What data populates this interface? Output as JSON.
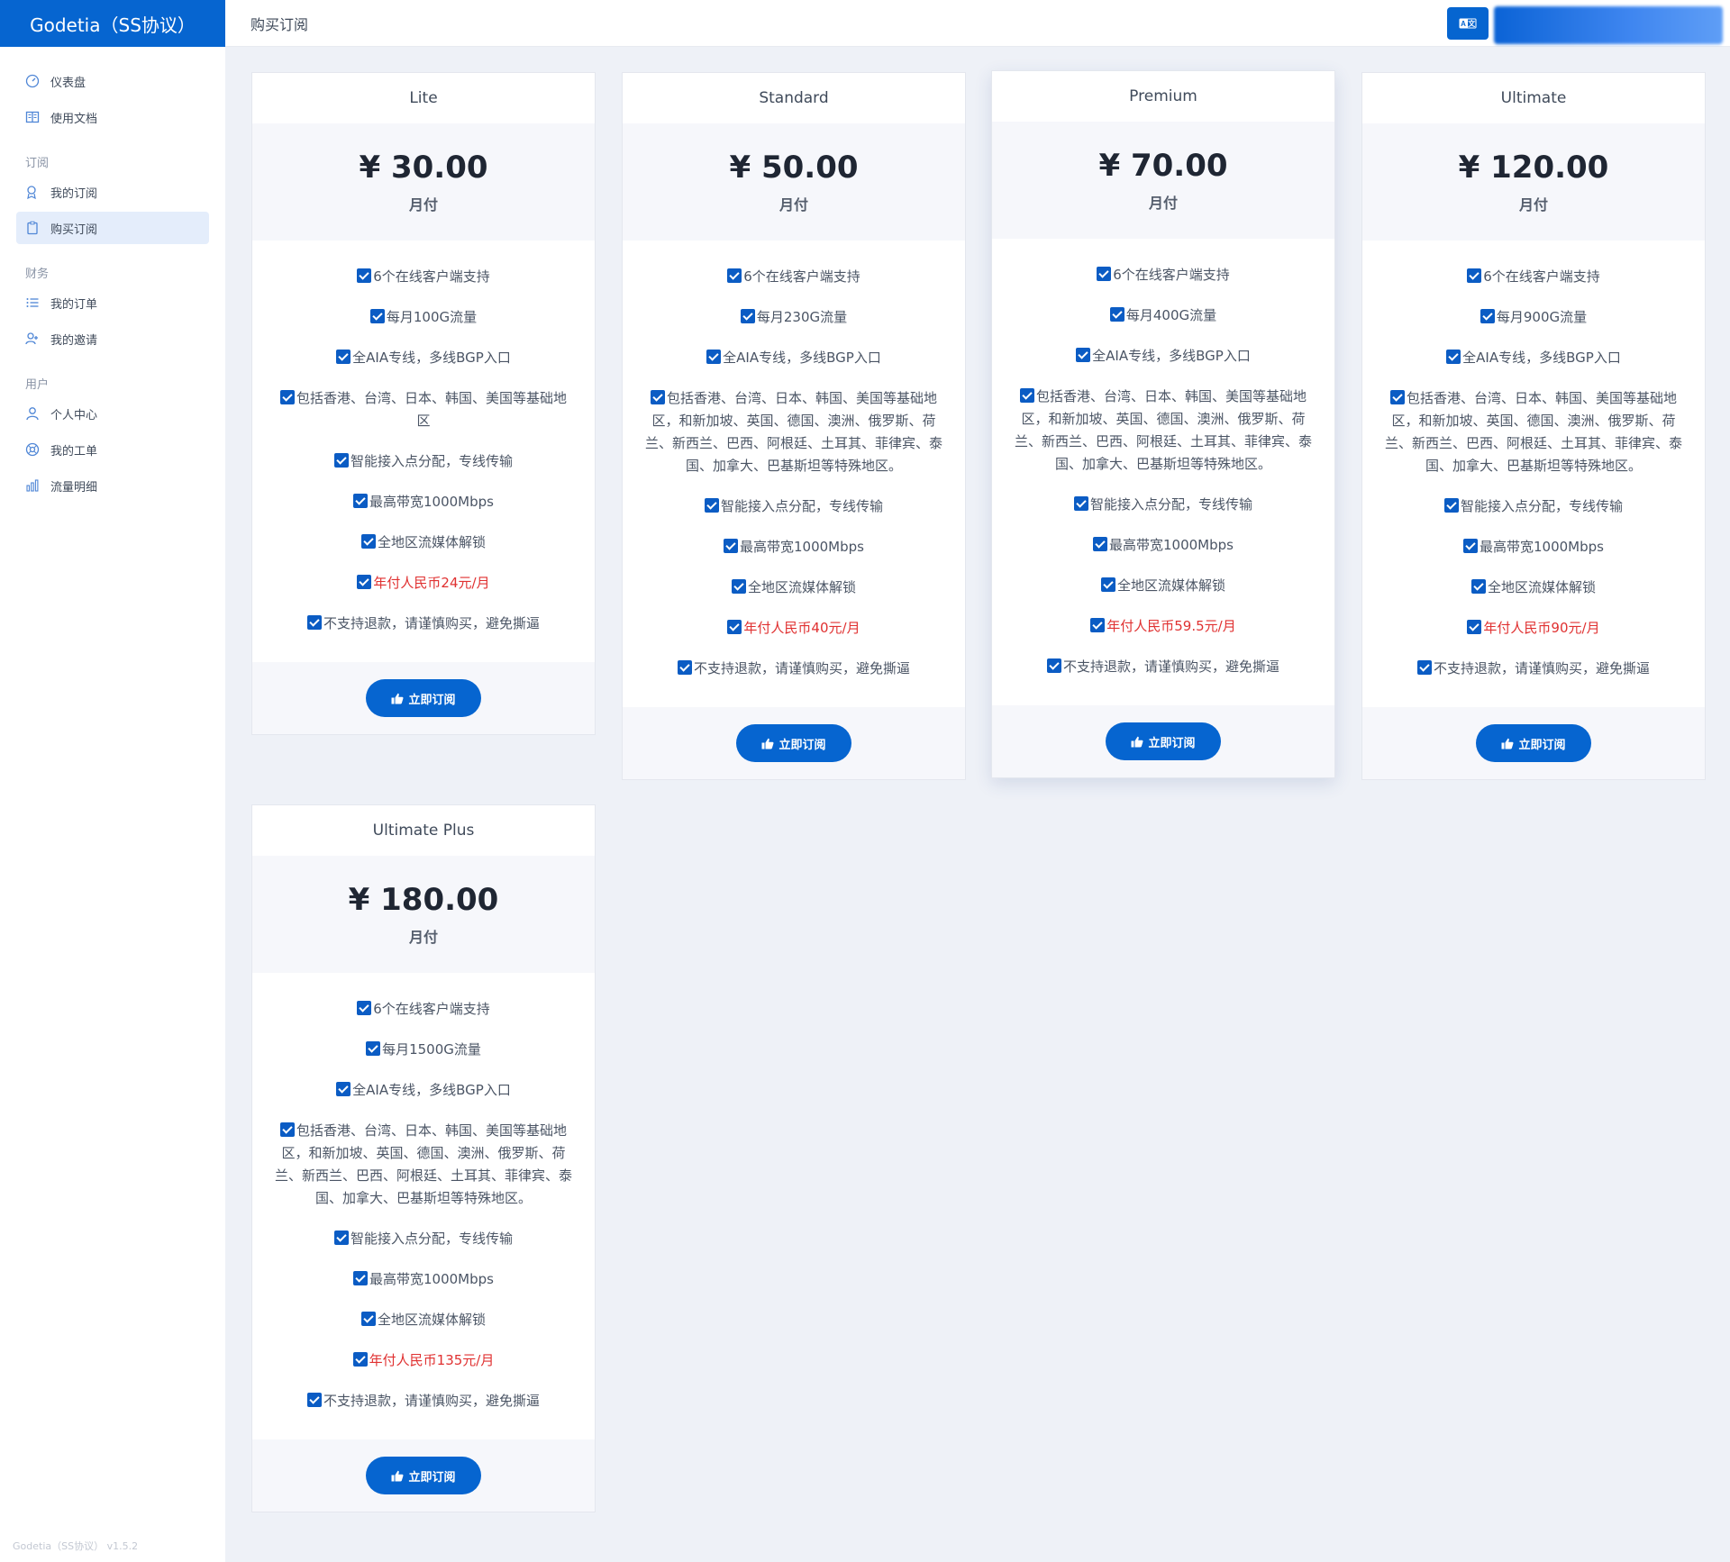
{
  "brand": "Godetia（SS协议）",
  "header": {
    "title": "购买订阅"
  },
  "sidebar": {
    "items": [
      {
        "label": "仪表盘",
        "icon": "dashboard-icon"
      },
      {
        "label": "使用文档",
        "icon": "book-icon"
      }
    ],
    "groups": [
      {
        "title": "订阅",
        "items": [
          {
            "label": "我的订阅",
            "icon": "subscription-icon"
          },
          {
            "label": "购买订阅",
            "icon": "clipboard-icon",
            "active": true
          }
        ]
      },
      {
        "title": "财务",
        "items": [
          {
            "label": "我的订单",
            "icon": "list-icon"
          },
          {
            "label": "我的邀请",
            "icon": "invite-icon"
          }
        ]
      },
      {
        "title": "用户",
        "items": [
          {
            "label": "个人中心",
            "icon": "user-icon"
          },
          {
            "label": "我的工单",
            "icon": "ticket-icon"
          },
          {
            "label": "流量明细",
            "icon": "bar-chart-icon"
          }
        ]
      }
    ],
    "footer": "Godetia（SS协议） v1.5.2"
  },
  "subscribe_label": "立即订阅",
  "plans": [
    {
      "name": "Lite",
      "price": "¥ 30.00",
      "period": "月付",
      "features": [
        {
          "text": "6个在线客户端支持"
        },
        {
          "text": "每月100G流量"
        },
        {
          "text": "全AIA专线，多线BGP入口"
        },
        {
          "text": "包括香港、台湾、日本、韩国、美国等基础地区"
        },
        {
          "text": "智能接入点分配，专线传输"
        },
        {
          "text": "最高带宽1000Mbps"
        },
        {
          "text": "全地区流媒体解锁"
        },
        {
          "text": "年付人民币24元/月",
          "red": true
        },
        {
          "text": "不支持退款，请谨慎购买，避免撕逼"
        }
      ]
    },
    {
      "name": "Standard",
      "price": "¥ 50.00",
      "period": "月付",
      "features": [
        {
          "text": "6个在线客户端支持"
        },
        {
          "text": "每月230G流量"
        },
        {
          "text": "全AIA专线，多线BGP入口"
        },
        {
          "text": "包括香港、台湾、日本、韩国、美国等基础地区，和新加坡、英国、德国、澳洲、俄罗斯、荷兰、新西兰、巴西、阿根廷、土耳其、菲律宾、泰国、加拿大、巴基斯坦等特殊地区。"
        },
        {
          "text": "智能接入点分配，专线传输"
        },
        {
          "text": "最高带宽1000Mbps"
        },
        {
          "text": "全地区流媒体解锁"
        },
        {
          "text": "年付人民币40元/月",
          "red": true
        },
        {
          "text": "不支持退款，请谨慎购买，避免撕逼"
        }
      ]
    },
    {
      "name": "Premium",
      "price": "¥ 70.00",
      "period": "月付",
      "features": [
        {
          "text": "6个在线客户端支持"
        },
        {
          "text": "每月400G流量"
        },
        {
          "text": "全AIA专线，多线BGP入口"
        },
        {
          "text": "包括香港、台湾、日本、韩国、美国等基础地区，和新加坡、英国、德国、澳洲、俄罗斯、荷兰、新西兰、巴西、阿根廷、土耳其、菲律宾、泰国、加拿大、巴基斯坦等特殊地区。"
        },
        {
          "text": "智能接入点分配，专线传输"
        },
        {
          "text": "最高带宽1000Mbps"
        },
        {
          "text": "全地区流媒体解锁"
        },
        {
          "text": "年付人民币59.5元/月",
          "red": true
        },
        {
          "text": "不支持退款，请谨慎购买，避免撕逼"
        }
      ]
    },
    {
      "name": "Ultimate",
      "price": "¥ 120.00",
      "period": "月付",
      "features": [
        {
          "text": "6个在线客户端支持"
        },
        {
          "text": "每月900G流量"
        },
        {
          "text": "全AIA专线，多线BGP入口"
        },
        {
          "text": "包括香港、台湾、日本、韩国、美国等基础地区，和新加坡、英国、德国、澳洲、俄罗斯、荷兰、新西兰、巴西、阿根廷、土耳其、菲律宾、泰国、加拿大、巴基斯坦等特殊地区。"
        },
        {
          "text": "智能接入点分配，专线传输"
        },
        {
          "text": "最高带宽1000Mbps"
        },
        {
          "text": "全地区流媒体解锁"
        },
        {
          "text": "年付人民币90元/月",
          "red": true
        },
        {
          "text": "不支持退款，请谨慎购买，避免撕逼"
        }
      ]
    },
    {
      "name": "Ultimate Plus",
      "price": "¥ 180.00",
      "period": "月付",
      "features": [
        {
          "text": "6个在线客户端支持"
        },
        {
          "text": "每月1500G流量"
        },
        {
          "text": "全AIA专线，多线BGP入口"
        },
        {
          "text": "包括香港、台湾、日本、韩国、美国等基础地区，和新加坡、英国、德国、澳洲、俄罗斯、荷兰、新西兰、巴西、阿根廷、土耳其、菲律宾、泰国、加拿大、巴基斯坦等特殊地区。"
        },
        {
          "text": "智能接入点分配，专线传输"
        },
        {
          "text": "最高带宽1000Mbps"
        },
        {
          "text": "全地区流媒体解锁"
        },
        {
          "text": "年付人民币135元/月",
          "red": true
        },
        {
          "text": "不支持退款，请谨慎购买，避免撕逼"
        }
      ]
    }
  ],
  "colors": {
    "primary": "#0665d0",
    "accent_text": "#e03131",
    "background": "#eef1f7"
  }
}
